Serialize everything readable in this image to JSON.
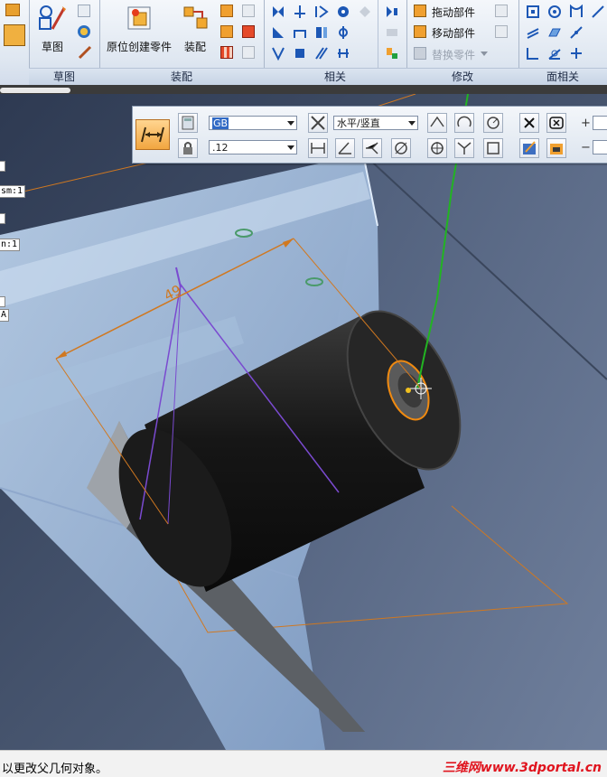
{
  "ribbon": {
    "groups": [
      {
        "label": "草图",
        "big_button": "草图"
      },
      {
        "label": "装配",
        "buttons": [
          "原位创建零件",
          "装配"
        ]
      },
      {
        "label": "相关"
      },
      {
        "label": "修改",
        "buttons": [
          "拖动部件",
          "移动部件",
          "替换零件"
        ]
      },
      {
        "label": "面相关"
      }
    ]
  },
  "dim_toolbar": {
    "standard_value": "GB",
    "orientation_value": "水平/竖直",
    "precision_value": ".12"
  },
  "browser_tags": [
    "sm:1",
    "n:1",
    "A"
  ],
  "dimension_label": "49",
  "status_bar": {
    "text": "以更改父几何对象。",
    "watermark": "三维网www.3dportal.cn"
  },
  "colors": {
    "ribbon_bg": "#dfe7f1",
    "viewport_bg": "#4e5b72",
    "dimension_orange": "#d07820",
    "axis_green": "#22b422",
    "watermark_red": "#e0141e"
  }
}
